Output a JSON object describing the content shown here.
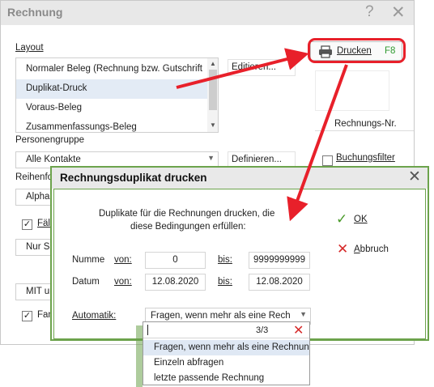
{
  "main_window": {
    "title": "Rechnung",
    "help_icon": "?",
    "close_icon": "✕",
    "layout_label": "Layout",
    "layout_items": [
      "Normaler Beleg (Rechnung bzw. Gutschrift",
      "Duplikat-Druck",
      "Voraus-Beleg",
      "Zusammenfassungs-Beleg"
    ],
    "edit_button": "Editieren...",
    "persons_label": "Personengruppe",
    "persons_value": "Alle Kontakte",
    "define_button": "Definieren...",
    "order_label_partial": "Reihenfo",
    "order_value_partial": "Alpha",
    "check1_label_partial": "Fäll",
    "check1_checked": "✓",
    "only_partial": "Nur Sa",
    "mit_partial": "MIT ur",
    "check2_label_partial": "Fam",
    "check2_checked": "✓",
    "print_label": "Drucken",
    "print_key": "F8",
    "invoice_no_label": "Rechnungs-Nr.",
    "filter_label": "Buchungsfilter"
  },
  "dialog": {
    "title": "Rechnungsduplikat drucken",
    "close_icon": "✕",
    "description_line1": "Duplikate für die Rechnungen drucken, die",
    "description_line2": "diese Bedingungen erfüllen:",
    "number_label": "Numme",
    "number_from_label": "von:",
    "number_from": "0",
    "number_to_label": "bis:",
    "number_to": "9999999999",
    "date_label": "Datum",
    "date_from_label": "von:",
    "date_from": "12.08.2020",
    "date_to_label": "bis:",
    "date_to": "12.08.2020",
    "auto_label": "Automatik:",
    "auto_value": "Fragen, wenn mehr als eine Rech",
    "ok_icon": "✓",
    "ok_label": "OK",
    "cancel_icon": "✕",
    "cancel_label": "Abbruch",
    "search_count": "3/3",
    "search_clear_icon": "✕",
    "dropdown_options": [
      "Fragen, wenn mehr als eine Rechnun",
      "Einzeln abfragen",
      "letzte passende Rechnung"
    ]
  },
  "colors": {
    "highlight_red": "#e8202a",
    "dialog_border": "#6ca34c",
    "ok_green": "#4a9a2a",
    "cancel_red": "#d62a2a",
    "fkey_green": "#2f9a2f"
  }
}
